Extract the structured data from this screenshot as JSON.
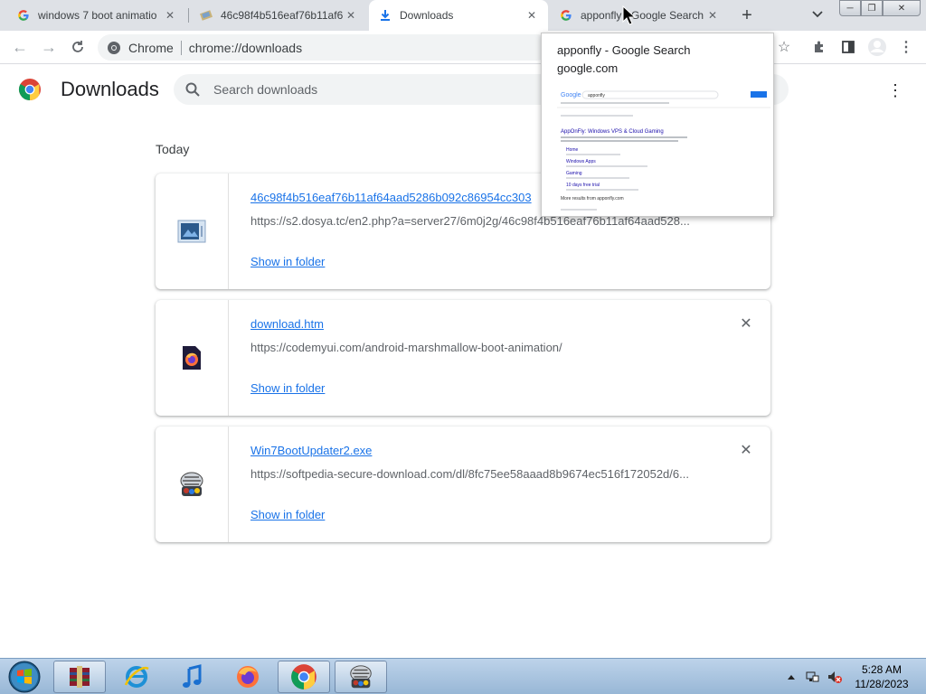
{
  "tabs": [
    {
      "title": "windows 7 boot animatio",
      "icon": "google-g-icon"
    },
    {
      "title": "46c98f4b516eaf76b11af6",
      "icon": "file-image-icon"
    },
    {
      "title": "Downloads",
      "icon": "download-icon",
      "active": true
    },
    {
      "title": "apponfly - Google Search",
      "icon": "google-g-icon"
    }
  ],
  "omnibox": {
    "chip": "Chrome",
    "url": "chrome://downloads"
  },
  "downloads": {
    "title": "Downloads",
    "search_placeholder": "Search downloads",
    "section": "Today",
    "items": [
      {
        "name": "46c98f4b516eaf76b11af64aad5286b092c86954cc303",
        "url": "https://s2.dosya.tc/en2.php?a=server27/6m0j2g/46c98f4b516eaf76b11af64aad528...",
        "action": "Show in folder",
        "icon": "image-file-icon"
      },
      {
        "name": "download.htm",
        "url": "https://codemyui.com/android-marshmallow-boot-animation/",
        "action": "Show in folder",
        "icon": "firefox-html-file-icon"
      },
      {
        "name": "Win7BootUpdater2.exe",
        "url": "https://softpedia-secure-download.com/dl/8fc75ee58aaad8b9674ec516f172052d/6...",
        "action": "Show in folder",
        "icon": "installer-app-icon"
      }
    ]
  },
  "hovercard": {
    "title": "apponfly - Google Search",
    "domain": "google.com",
    "thumb": {
      "logo": "Google",
      "query": "apponfly",
      "heading": "AppOnFly: Windows VPS & Cloud Gaming",
      "results": [
        "Home",
        "Windows Apps",
        "Gaming",
        "10 days free trial"
      ],
      "more": "More results from apponfly.com"
    }
  },
  "taskbar": {
    "apps": [
      "winrar",
      "internet-explorer",
      "itunes",
      "firefox",
      "chrome",
      "installer"
    ],
    "time": "5:28 AM",
    "date": "11/28/2023"
  },
  "colors": {
    "accent": "#1a73e8",
    "tabstrip": "#dee1e6"
  }
}
